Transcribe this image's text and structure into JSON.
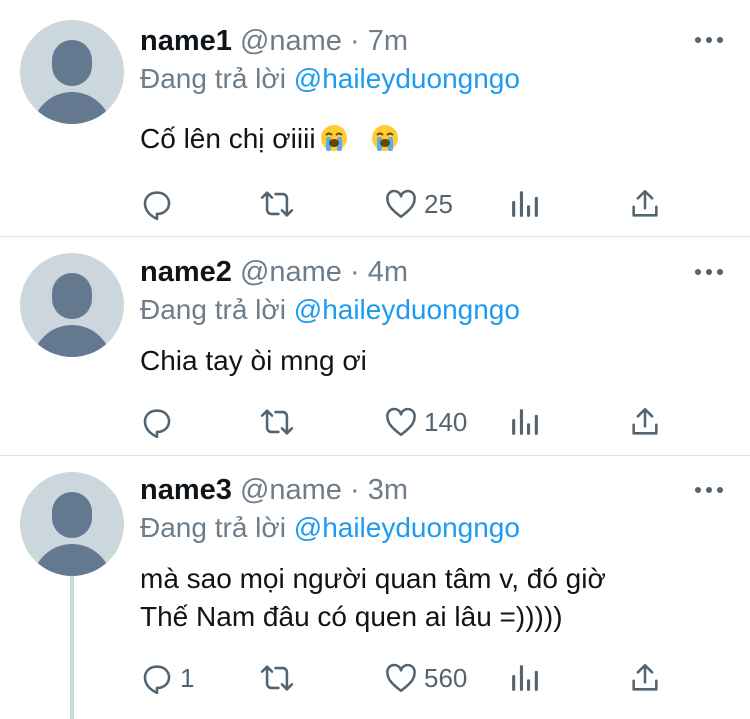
{
  "tweets": [
    {
      "name": "name1",
      "handle": "@name",
      "separator": "·",
      "time": "7m",
      "reply_prefix": "Đang trả lời",
      "reply_to": "@haileyduongngo",
      "text_lines": [
        "Cố lên chị ơiiii"
      ],
      "emoji": [
        "loudly-crying-face-emoji",
        "loudly-crying-face-emoji"
      ],
      "reply_count": "",
      "like_count": "25"
    },
    {
      "name": "name2",
      "handle": "@name",
      "separator": "·",
      "time": "4m",
      "reply_prefix": "Đang trả lời",
      "reply_to": "@haileyduongngo",
      "text_lines": [
        "Chia tay òi mng ơi"
      ],
      "reply_count": "",
      "like_count": "140"
    },
    {
      "name": "name3",
      "handle": "@name",
      "separator": "·",
      "time": "3m",
      "reply_prefix": "Đang trả lời",
      "reply_to": "@haileyduongngo",
      "text_lines": [
        "mà sao mọi người quan tâm v, đó giờ",
        "Thế Nam đâu có quen ai lâu =)))))"
      ],
      "reply_count": "1",
      "like_count": "560"
    }
  ],
  "icons": [
    "more-icon",
    "reply-icon",
    "retweet-icon",
    "like-icon",
    "analytics-icon",
    "share-icon"
  ],
  "colors": {
    "accent": "#1d9bf0",
    "secondary_text": "#6e7d8a",
    "icon": "#536471",
    "divider": "#dfe4e8",
    "avatar_bg": "#ccd6dd",
    "avatar_fg": "#647890"
  }
}
